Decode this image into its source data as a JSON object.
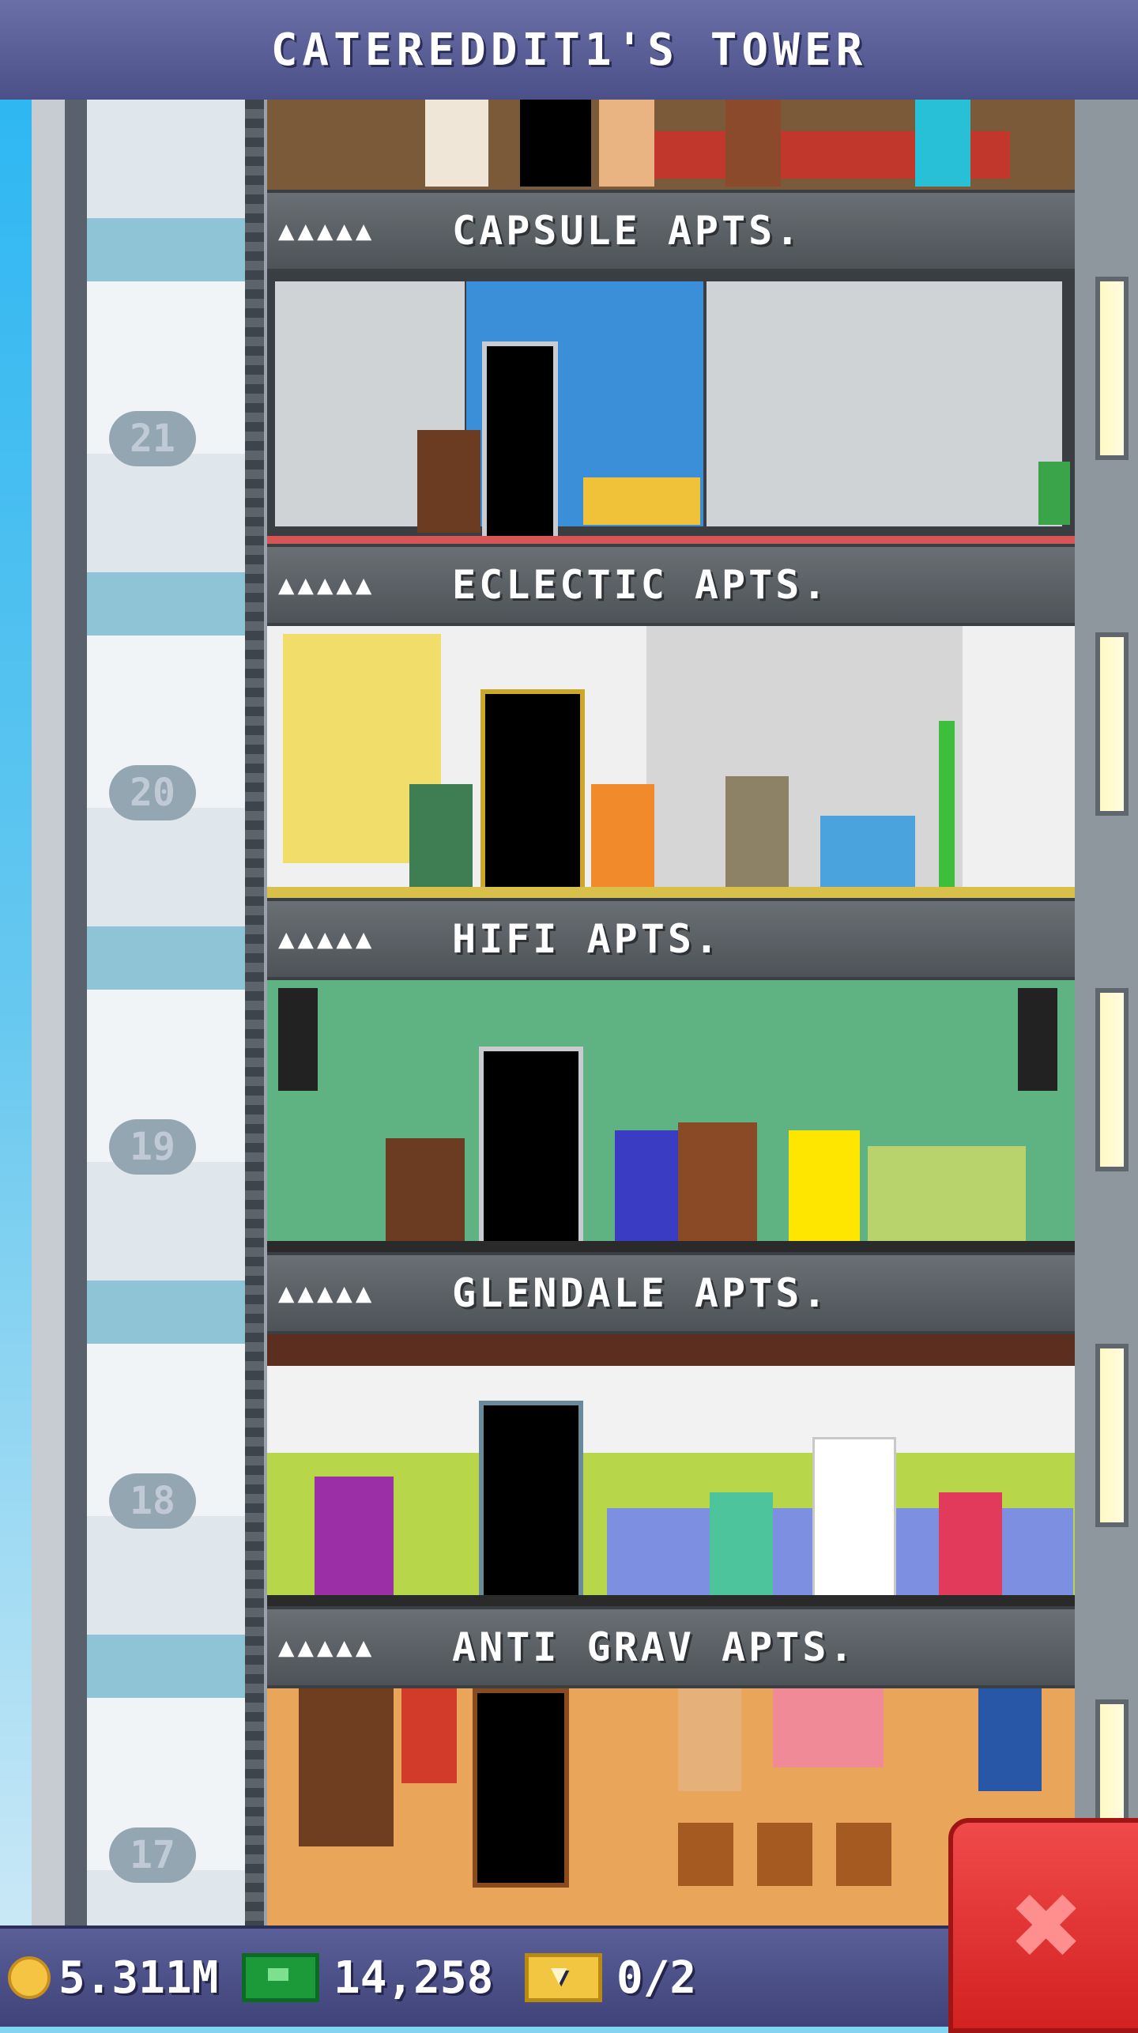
{
  "header": {
    "title": "CATEREDDIT1'S TOWER"
  },
  "floors": [
    {
      "number": "21",
      "rating": "▲▲▲▲▲",
      "name": "CAPSULE APTS."
    },
    {
      "number": "20",
      "rating": "▲▲▲▲▲",
      "name": "ECLECTIC APTS."
    },
    {
      "number": "19",
      "rating": "▲▲▲▲▲",
      "name": "HIFI APTS."
    },
    {
      "number": "18",
      "rating": "▲▲▲▲▲",
      "name": "GLENDALE APTS."
    },
    {
      "number": "17",
      "rating": "▲▲▲▲▲",
      "name": "ANTI GRAV APTS."
    }
  ],
  "footer": {
    "coins": "5.311M",
    "bux": "14,258",
    "tickets": "0/2"
  },
  "icons": {
    "coin": "coin-icon",
    "bux": "tower-bux-icon",
    "ticket": "ticket-icon",
    "close": "close-icon"
  },
  "colors": {
    "header": "#5a5f98",
    "close_button": "#e03030",
    "coin": "#f6c443",
    "bux": "#1c9a3a"
  }
}
